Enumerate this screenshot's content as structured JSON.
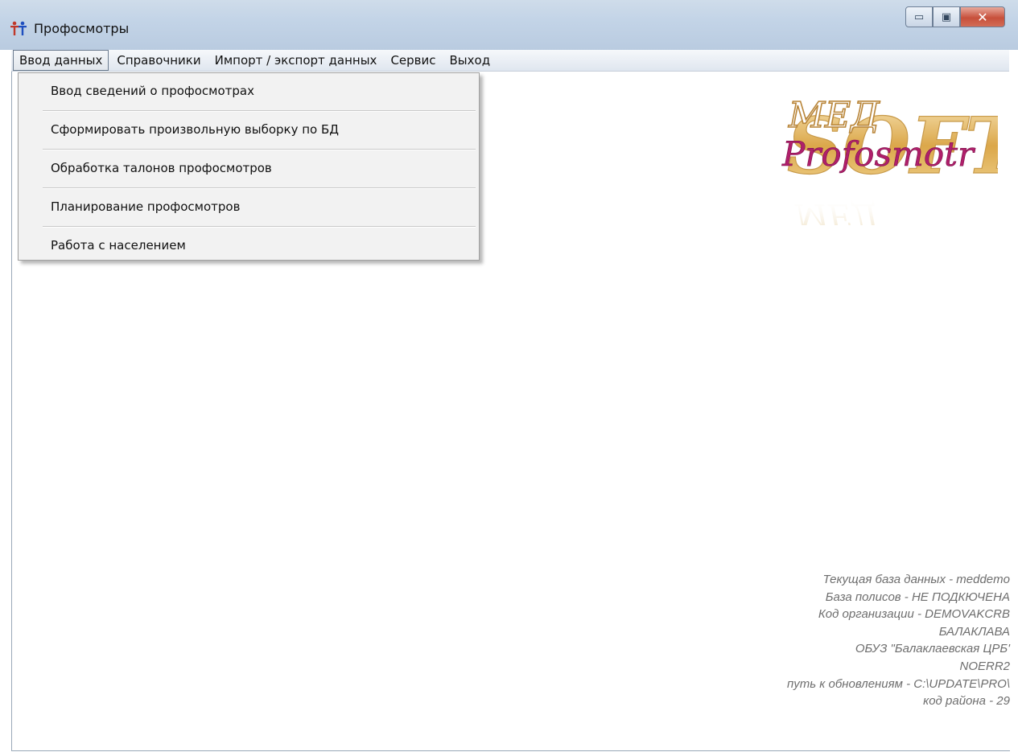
{
  "window": {
    "title": "Профосмотры",
    "icon": "people-icon",
    "controls": {
      "minimize_glyph": "▭",
      "maximize_glyph": "▣",
      "close_glyph": "✕"
    }
  },
  "menubar": {
    "items": [
      {
        "label": "Ввод данных",
        "active": true
      },
      {
        "label": "Справочники"
      },
      {
        "label": "Импорт / экспорт данных"
      },
      {
        "label": "Сервис"
      },
      {
        "label": "Выход"
      }
    ]
  },
  "dropdown": {
    "items": [
      {
        "label": "Ввод сведений о профосмотрах"
      },
      {
        "label": "Сформировать произвольную выборку по БД"
      },
      {
        "label": "Обработка талонов профосмотров"
      },
      {
        "label": "Планирование профосмотров"
      },
      {
        "label": "Работа с населением"
      }
    ]
  },
  "logo": {
    "top_text": "МЕД",
    "big_text": "SOFT",
    "script_text": "Profosmotr",
    "mirror_text": "МЕД"
  },
  "info": {
    "lines": [
      "Текущая база данных - meddemo",
      "База полисов - НЕ ПОДКЮЧЕНА",
      "Код организации - DEMOVAKCRB",
      "БАЛАКЛАВА",
      "ОБУЗ \"Балаклаевская ЦРБ'",
      "NOERR2",
      "путь к обновлениям - C:\\UPDATE\\PRO\\",
      "код района - 29"
    ]
  },
  "colors": {
    "titlebar": "#c3d4e7",
    "logo_gold": "#d9a441",
    "logo_pink": "#b01f6b",
    "info_text": "#6e6e6e"
  }
}
